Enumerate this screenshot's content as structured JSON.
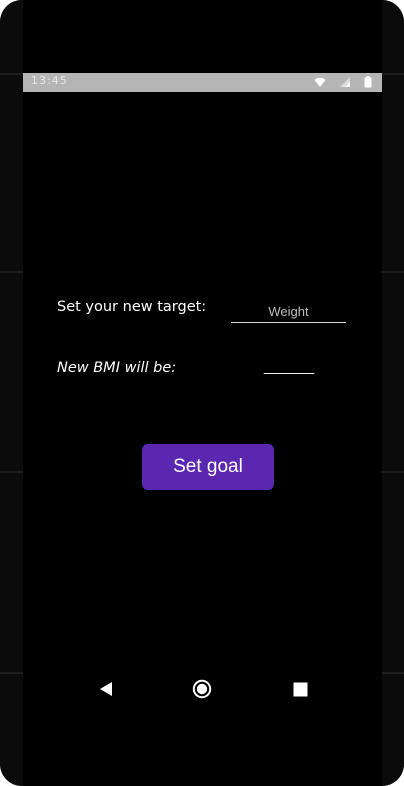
{
  "status_bar": {
    "time": "13:45",
    "icons": [
      "wifi-icon",
      "signal-icon",
      "battery-icon"
    ]
  },
  "form": {
    "target_label": "Set your new target:",
    "weight_placeholder": "Weight",
    "weight_value": "",
    "bmi_label": "New BMI will be:",
    "bmi_value": "______"
  },
  "actions": {
    "set_goal_label": "Set goal"
  },
  "navigation": {
    "items": [
      "back-icon",
      "home-icon",
      "recents-icon"
    ]
  },
  "colors": {
    "background": "#000000",
    "status_bar": "#b5b5b5",
    "button": "#5b27b0",
    "text": "#ffffff"
  }
}
